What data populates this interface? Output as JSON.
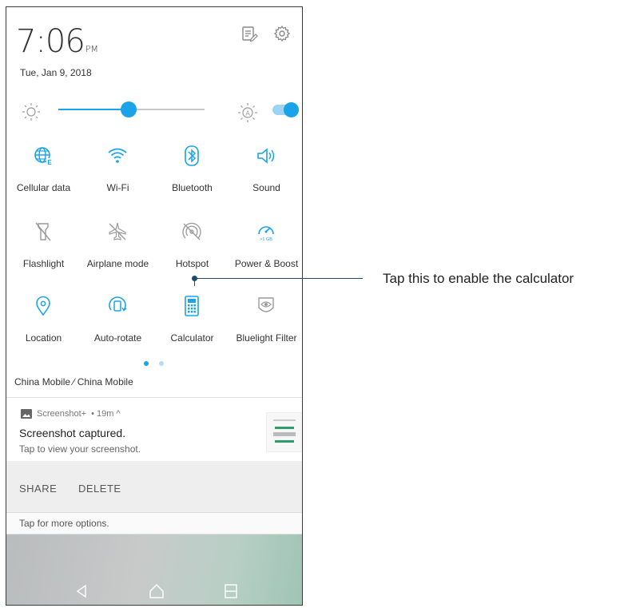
{
  "status": {
    "time": "7:06",
    "ampm": "PM",
    "date": "Tue, Jan 9, 2018"
  },
  "header": {
    "icons": [
      "edit-tiles-icon",
      "settings-gear-icon"
    ]
  },
  "brightness": {
    "level": 0.48,
    "auto_enabled": true,
    "auto_icon_letter": "A"
  },
  "tiles": [
    {
      "label": "Cellular data",
      "icon": "cellular-data-icon",
      "active": true
    },
    {
      "label": "Wi-Fi",
      "icon": "wifi-icon",
      "active": true
    },
    {
      "label": "Bluetooth",
      "icon": "bluetooth-icon",
      "active": true
    },
    {
      "label": "Sound",
      "icon": "sound-icon",
      "active": true
    },
    {
      "label": "Flashlight",
      "icon": "flashlight-icon",
      "active": false
    },
    {
      "label": "Airplane mode",
      "icon": "airplane-icon",
      "active": false
    },
    {
      "label": "Hotspot",
      "icon": "hotspot-icon",
      "active": false
    },
    {
      "label": "Power & Boost",
      "icon": "power-boost-icon",
      "active": true,
      "badge": ">1 GB"
    },
    {
      "label": "Location",
      "icon": "location-icon",
      "active": true
    },
    {
      "label": "Auto-rotate",
      "icon": "auto-rotate-icon",
      "active": true
    },
    {
      "label": "Calculator",
      "icon": "calculator-icon",
      "active": true
    },
    {
      "label": "Bluelight Filter",
      "icon": "bluelight-filter-icon",
      "active": false
    }
  ],
  "pager": {
    "pages": 2,
    "current": 1
  },
  "carrier": "China Mobile ⁄ China Mobile",
  "notification": {
    "app": "Screenshot+",
    "age": "• 19m ^",
    "title": "Screenshot captured.",
    "text": "Tap to view your screenshot.",
    "actions": {
      "share": "SHARE",
      "delete": "DELETE"
    },
    "more": "Tap for more options."
  },
  "navbar": {
    "icons": [
      "back-icon",
      "home-icon",
      "recents-icon"
    ]
  },
  "callout": {
    "text": "Tap this to enable the calculator"
  },
  "colors": {
    "accent": "#1aa3e8",
    "inactive": "#9a9a9a",
    "callout": "#1e4a6b"
  }
}
